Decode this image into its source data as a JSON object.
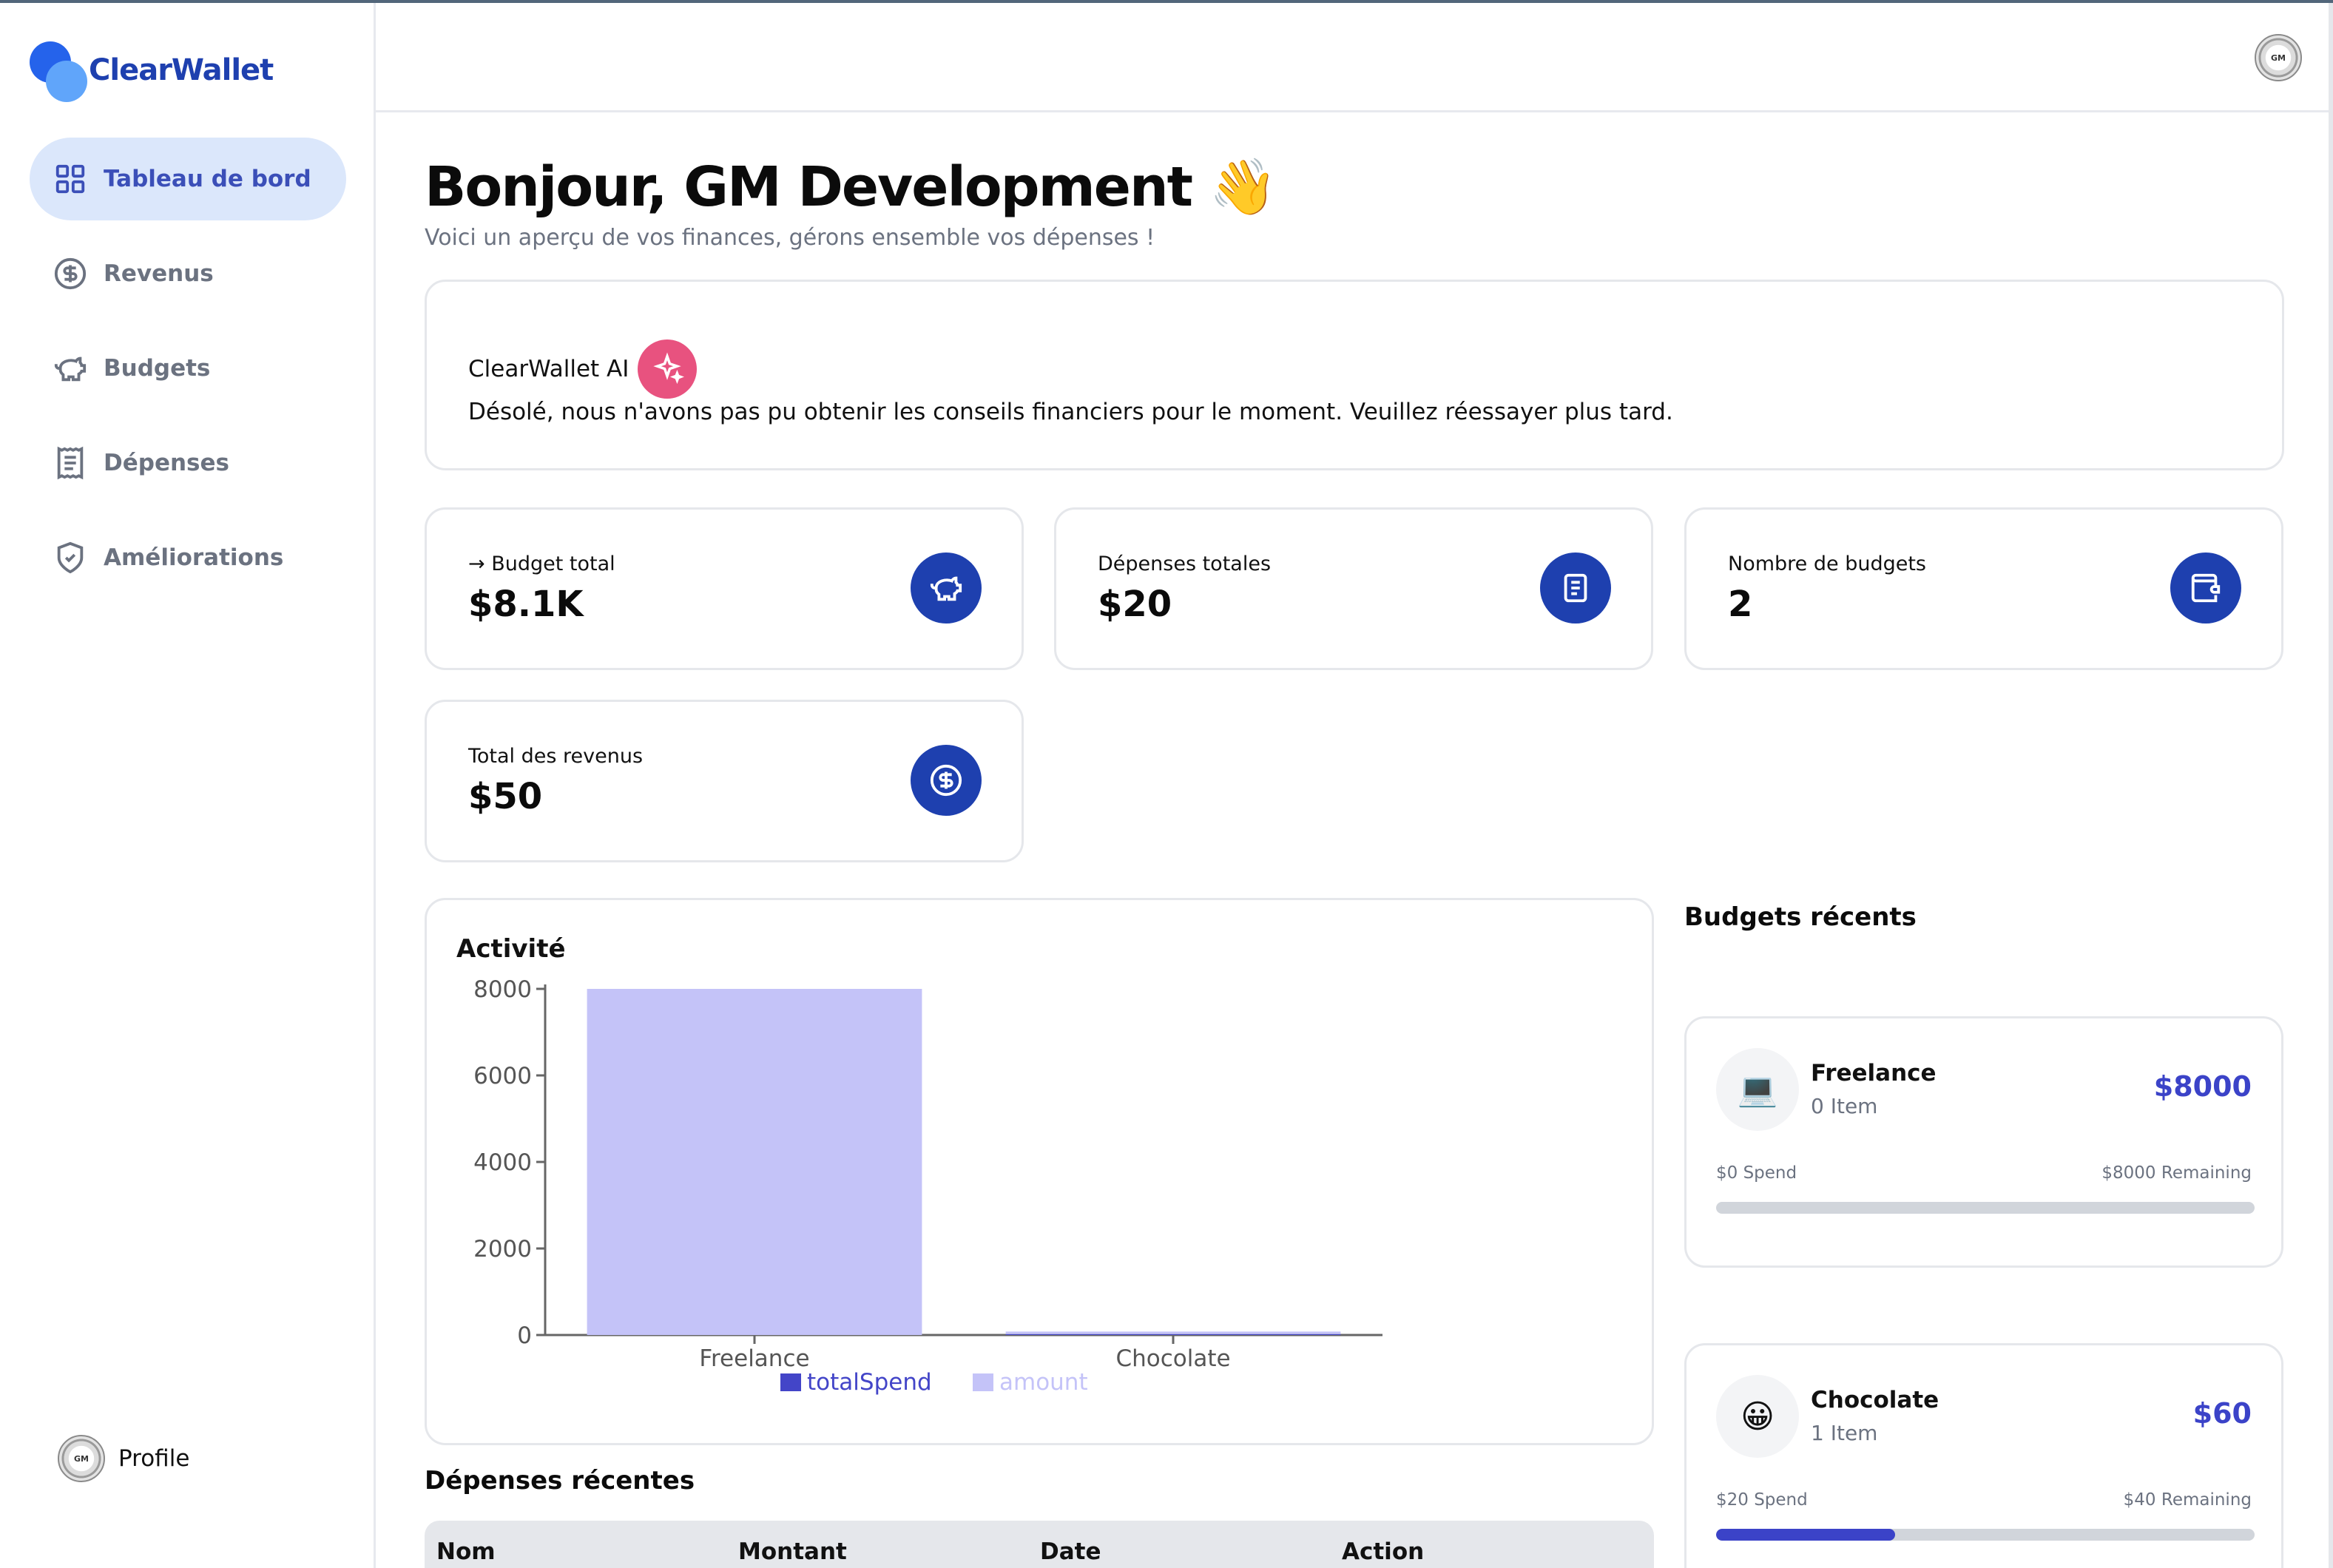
{
  "app": {
    "name": "ClearWallet"
  },
  "sidebar": {
    "items": [
      {
        "label": "Tableau de bord",
        "icon": "grid-icon",
        "active": true
      },
      {
        "label": "Revenus",
        "icon": "dollar-circle-icon",
        "active": false
      },
      {
        "label": "Budgets",
        "icon": "piggy-bank-icon",
        "active": false
      },
      {
        "label": "Dépenses",
        "icon": "receipt-icon",
        "active": false
      },
      {
        "label": "Améliorations",
        "icon": "shield-check-icon",
        "active": false
      }
    ],
    "profile_label": "Profile",
    "avatar_text": "GM"
  },
  "header": {
    "avatar_text": "GM"
  },
  "greeting": {
    "title": "Bonjour, GM Development 👋",
    "subtitle": "Voici un aperçu de vos finances, gérons ensemble vos dépenses !"
  },
  "ai": {
    "title": "ClearWallet AI",
    "message": "Désolé, nous n'avons pas pu obtenir les conseils financiers pour le moment. Veuillez réessayer plus tard."
  },
  "stats": [
    {
      "label": "→ Budget total",
      "value": "$8.1K",
      "icon": "piggy-bank-icon"
    },
    {
      "label": "Dépenses totales",
      "value": "$20",
      "icon": "receipt-icon"
    },
    {
      "label": "Nombre de budgets",
      "value": "2",
      "icon": "wallet-icon"
    },
    {
      "label": "Total des revenus",
      "value": "$50",
      "icon": "dollar-circle-icon"
    }
  ],
  "activity": {
    "title": "Activité"
  },
  "chart_data": {
    "type": "bar",
    "categories": [
      "Freelance",
      "Chocolate"
    ],
    "series": [
      {
        "name": "totalSpend",
        "values": [
          0,
          20
        ],
        "color": "#4345c8"
      },
      {
        "name": "amount",
        "values": [
          8000,
          60
        ],
        "color": "#c4c3f8"
      }
    ],
    "stacked": true,
    "ylim": [
      0,
      8000
    ],
    "yticks": [
      0,
      2000,
      4000,
      6000,
      8000
    ],
    "legend": "bottom-center"
  },
  "recent_expenses": {
    "title": "Dépenses récentes",
    "columns": [
      "Nom",
      "Montant",
      "Date",
      "Action"
    ]
  },
  "recent_budgets": {
    "title": "Budgets récents",
    "items": [
      {
        "name": "Freelance",
        "items": "0 Item",
        "amount": "$8000",
        "spend": "$0 Spend",
        "remaining": "$8000 Remaining",
        "progress": 0,
        "emoji": "💻"
      },
      {
        "name": "Chocolate",
        "items": "1 Item",
        "amount": "$60",
        "spend": "$20 Spend",
        "remaining": "$40 Remaining",
        "progress": 0.333,
        "emoji": "😀"
      }
    ]
  },
  "colors": {
    "primary": "#1e40af",
    "accent": "#3b43c8",
    "active_nav": "#dbe7fb",
    "ai_badge": "#e8527f"
  }
}
